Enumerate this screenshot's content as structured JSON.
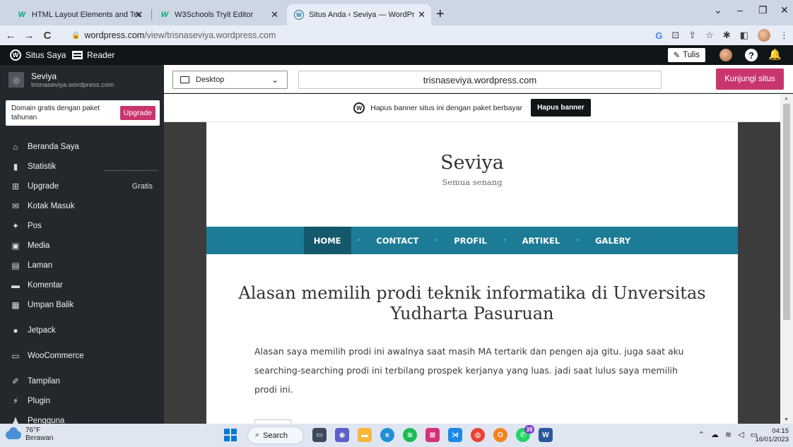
{
  "browser": {
    "tabs": [
      {
        "title": "HTML Layout Elements and Techn",
        "icon": "w3schools-icon",
        "active": false
      },
      {
        "title": "W3Schools Tryit Editor",
        "icon": "w3schools-icon",
        "active": false
      },
      {
        "title": "Situs Anda ‹ Seviya — WordPress",
        "icon": "wordpress-icon",
        "active": true
      }
    ],
    "url_domain": "wordpress.com",
    "url_path": "/view/trisnaseviya.wordpress.com"
  },
  "adminbar": {
    "my_site": "Situs Saya",
    "reader": "Reader",
    "write": "Tulis"
  },
  "sidebar": {
    "site_name": "Seviya",
    "site_url": "trisnaseviya.wordpress.com",
    "upsell_text": "Domain gratis dengan paket tahunan",
    "upsell_button": "Upgrade",
    "items": [
      {
        "label": "Beranda Saya",
        "icon": "home-icon"
      },
      {
        "label": "Statistik",
        "icon": "stats-icon"
      },
      {
        "label": "Upgrade",
        "icon": "cart-icon",
        "badge": "Gratis"
      },
      {
        "label": "Kotak Masuk",
        "icon": "mail-icon"
      },
      {
        "label": "Pos",
        "icon": "pin-icon"
      },
      {
        "label": "Media",
        "icon": "media-icon"
      },
      {
        "label": "Laman",
        "icon": "page-icon"
      },
      {
        "label": "Komentar",
        "icon": "comment-icon"
      },
      {
        "label": "Umpan Balik",
        "icon": "feedback-icon"
      },
      {
        "label": "Jetpack",
        "icon": "jetpack-icon"
      },
      {
        "label": "WooCommerce",
        "icon": "woocommerce-icon"
      },
      {
        "label": "Tampilan",
        "icon": "brush-icon"
      },
      {
        "label": "Plugin",
        "icon": "plugin-icon"
      },
      {
        "label": "Pengguna",
        "icon": "user-icon"
      }
    ]
  },
  "preview_bar": {
    "device": "Desktop",
    "url": "trisnaseviya.wordpress.com",
    "visit_button": "Kunjungi situs"
  },
  "banner": {
    "text": "Hapus banner situs ini dengan paket berbayar",
    "button": "Hapus banner"
  },
  "site": {
    "title": "Seviya",
    "tagline": "Semua senang",
    "nav": [
      "HOME",
      "CONTACT",
      "PROFIL",
      "ARTIKEL",
      "GALERY"
    ],
    "post_title": "Alasan memilih prodi teknik informatika di Unversitas Yudharta Pasuruan",
    "post_body": "Alasan saya memilih prodi ini awalnya saat masih MA tertarik dan pengen aja gitu. juga saat aku searching-searching prodi ini terbilang prospek kerjanya yang luas. jadi saat lulus saya memilih prodi ini."
  },
  "taskbar": {
    "temp": "76°F",
    "weather": "Berawan",
    "search": "Search",
    "time": "04:15",
    "date": "16/01/2023",
    "badge_count": "39"
  },
  "colors": {
    "accent": "#c9356e",
    "nav": "#1c7c96",
    "sidebar": "#23282d"
  }
}
